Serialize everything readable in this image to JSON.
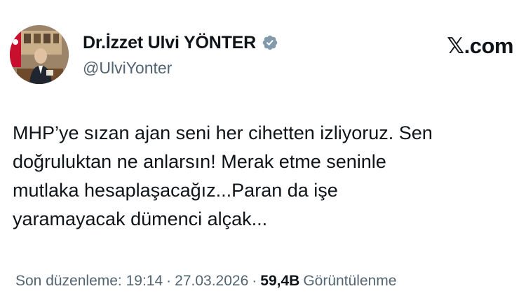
{
  "author": {
    "display_name": "Dr.İzzet Ulvi YÖNTER",
    "handle": "@UlviYonter",
    "verified_icon": "verified-badge-icon",
    "verified_color": "#829aab"
  },
  "brand": {
    "icon": "x-logo-icon",
    "text": "𝕏.com"
  },
  "tweet": {
    "text": "MHP’ye sızan ajan seni her cihetten izliyoruz. Sen\ndoğruluktan ne anlarsın! Merak etme seninle\nmutlaka hesaplaşacağız...Paran da işe\nyaramayacak dümenci alçak..."
  },
  "meta": {
    "edited_label": "Son düzenleme: 19:14",
    "separator": "·",
    "date": "27.03.2026",
    "views_count": "59,4B",
    "views_label": "Görüntülenme"
  },
  "colors": {
    "text_primary": "#0f1419",
    "text_secondary": "#536471"
  }
}
